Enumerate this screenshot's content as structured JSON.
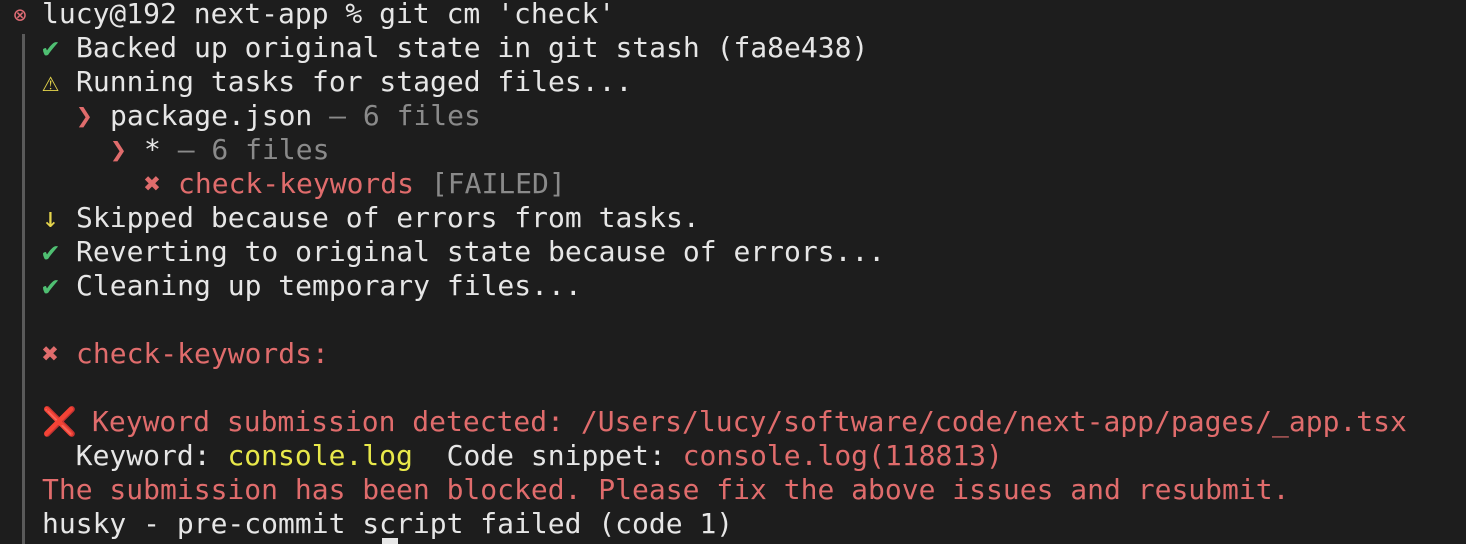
{
  "prompt": {
    "status_icon": "error-circle-icon",
    "text": "lucy@192 next-app % git cm 'check'"
  },
  "lines": {
    "l1": {
      "icon": "✔",
      "text": "Backed up original state in git stash (fa8e438)"
    },
    "l2": {
      "icon": "⚠",
      "text": "Running tasks for staged files..."
    },
    "l3": {
      "icon": "❯",
      "name": "package.json",
      "meta": "— 6 files"
    },
    "l4": {
      "icon": "❯",
      "name": "*",
      "meta": "— 6 files"
    },
    "l5": {
      "icon": "✖",
      "name": "check-keywords",
      "meta": "[FAILED]"
    },
    "l6": {
      "icon": "↓",
      "text": "Skipped because of errors from tasks."
    },
    "l7": {
      "icon": "✔",
      "text": "Reverting to original state because of errors..."
    },
    "l8": {
      "icon": "✔",
      "text": "Cleaning up temporary files..."
    },
    "l9": {
      "icon": "✖",
      "text": "check-keywords:"
    },
    "l10": {
      "icon": "❌",
      "text": "Keyword submission detected: /Users/lucy/software/code/next-app/pages/_app.tsx"
    },
    "l11": {
      "kw_label": "Keyword:",
      "kw_value": "console.log",
      "snip_label": "Code snippet:",
      "snip_value": "console.log(118813)"
    },
    "l12": {
      "text": "The submission has been blocked. Please fix the above issues and resubmit."
    },
    "l13": {
      "text": "husky - pre-commit script failed (code 1)"
    }
  },
  "colors": {
    "background": "#1d1d1d",
    "foreground": "#e6e6e6",
    "success": "#4fbf72",
    "warning": "#e5d54c",
    "error": "#e06c6c",
    "keyword": "#e8e84a",
    "dim": "#8a8a8a"
  }
}
